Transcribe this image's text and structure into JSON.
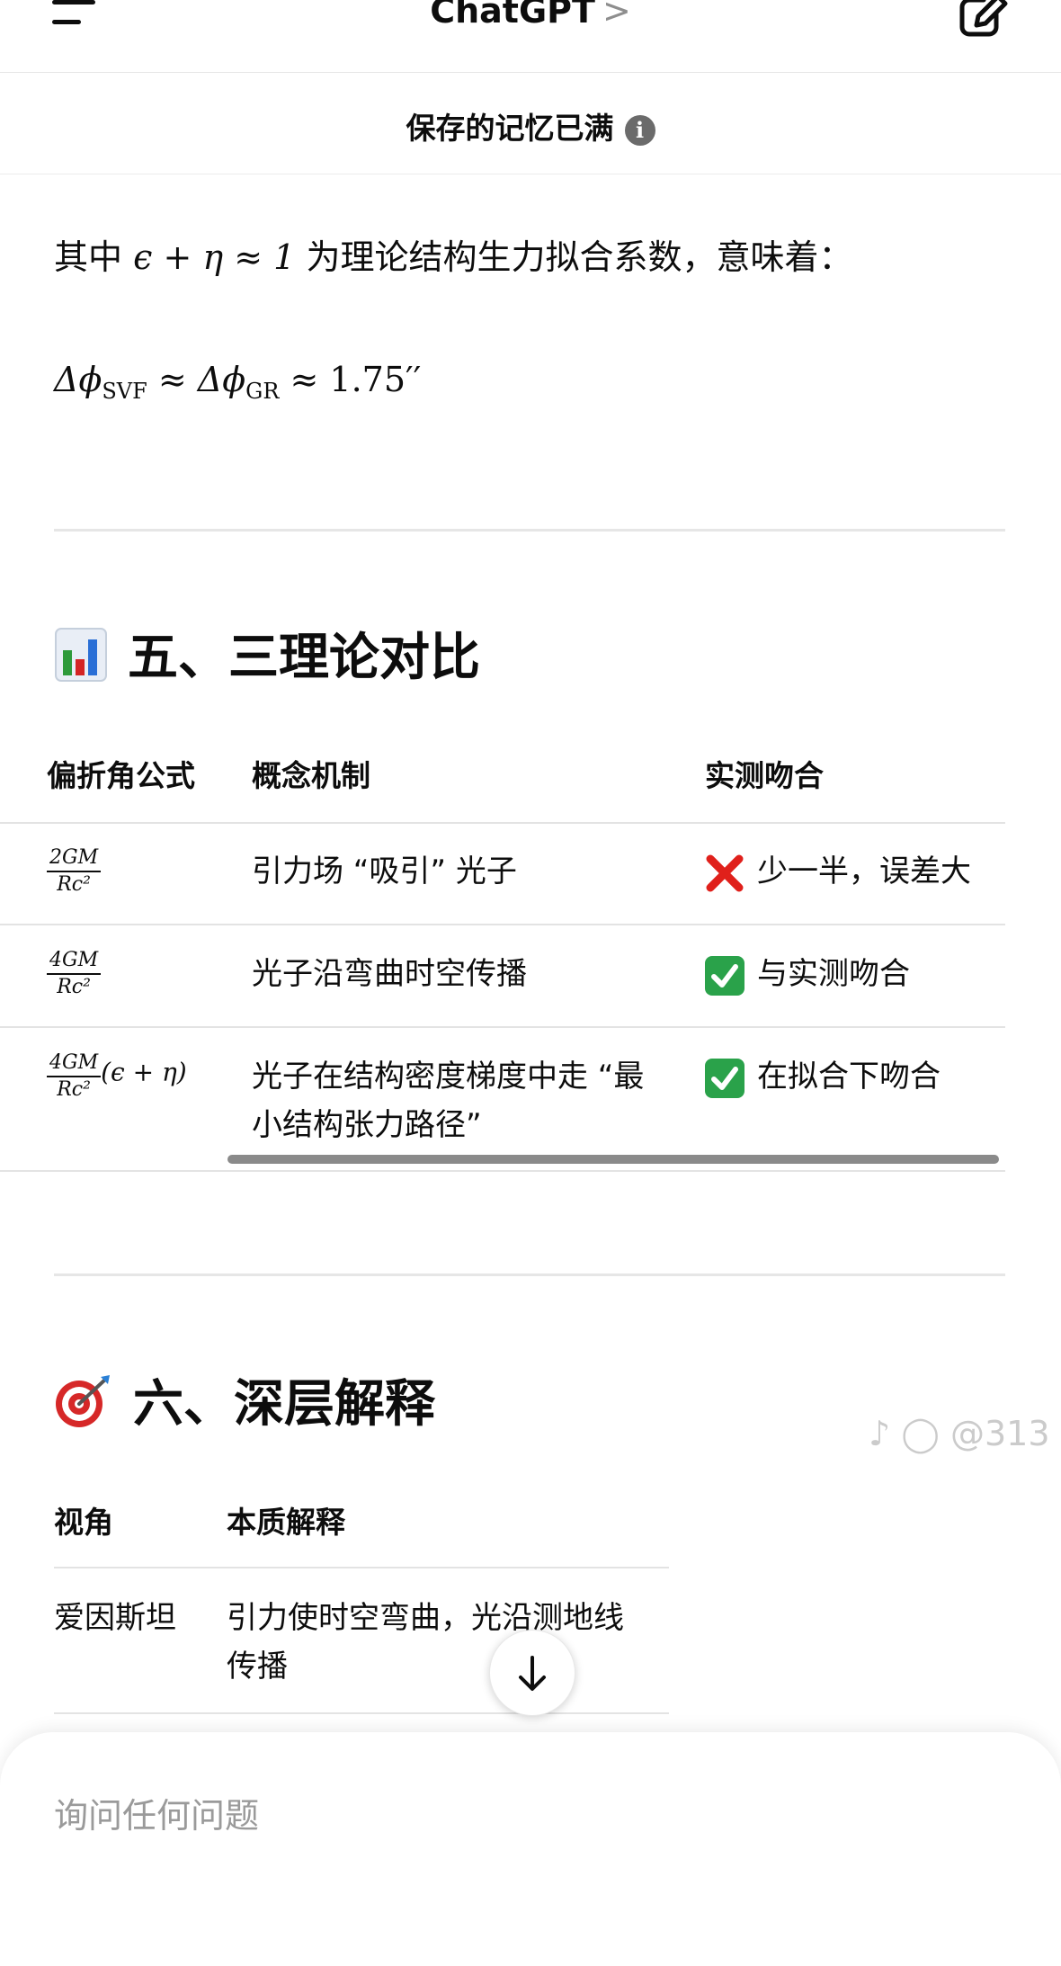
{
  "header": {
    "title": "ChatGPT",
    "chevron": ">"
  },
  "memory_banner": {
    "text": "保存的记忆已满",
    "info_symbol": "i"
  },
  "content": {
    "para_prefix": "其中",
    "para_math": "ϵ + η ≈ 1",
    "para_suffix": "为理论结构生力拟合系数，意味着：",
    "equation": {
      "part1": "Δϕ",
      "sub1": "SVF",
      "part2": " ≈ Δϕ",
      "sub2": "GR",
      "part3": " ≈ 1.75′′"
    },
    "section5": {
      "title": "五、三理论对比",
      "icon": "bar-chart-icon",
      "columns": [
        "偏折角公式",
        "概念机制",
        "实测吻合"
      ],
      "rows": [
        {
          "num": "2GM",
          "den": "Rc²",
          "suffix": "",
          "mechanism": "引力场 “吸引” 光子",
          "status": "cross",
          "match": "少一半，误差大"
        },
        {
          "num": "4GM",
          "den": "Rc²",
          "suffix": "",
          "mechanism": "光子沿弯曲时空传播",
          "status": "check",
          "match": "与实测吻合"
        },
        {
          "num": "4GM",
          "den": "Rc²",
          "suffix": "(ϵ + η)",
          "mechanism": "光子在结构密度梯度中走 “最小结构张力路径”",
          "status": "check",
          "match": "在拟合下吻合"
        }
      ]
    },
    "section6": {
      "title": "六、深层解释",
      "icon": "target-dart-icon",
      "columns": [
        "视角",
        "本质解释"
      ],
      "rows": [
        {
          "view": "爱因斯坦",
          "explain": "引力使时空弯曲，光沿测地线传播"
        }
      ]
    }
  },
  "composer": {
    "placeholder": "询问任何问题"
  },
  "watermark": "@313",
  "colors": {
    "check_green": "#2aa24a",
    "cross_red": "#e0201b"
  }
}
